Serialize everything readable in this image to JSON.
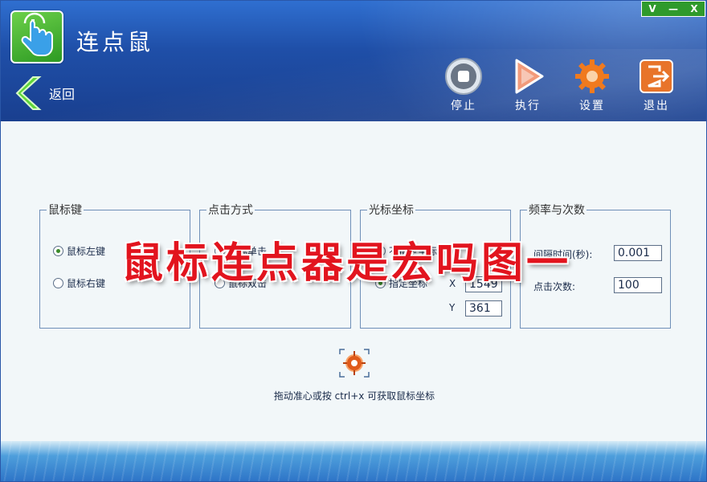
{
  "app": {
    "title": "连点鼠"
  },
  "window_controls": {
    "minimize": "V",
    "restore": "—",
    "close": "X"
  },
  "nav": {
    "back_label": "返回"
  },
  "toolbar": {
    "stop_label": "停止",
    "run_label": "执行",
    "settings_label": "设置",
    "exit_label": "退出"
  },
  "mouse_button": {
    "title": "鼠标键",
    "options": [
      "鼠标左键",
      "鼠标右键"
    ],
    "selected": "鼠标左键"
  },
  "click_mode": {
    "title": "点击方式",
    "options": [
      "鼠标单击",
      "鼠标双击"
    ],
    "selected": "鼠标单击"
  },
  "cursor_coords": {
    "title": "光标坐标",
    "options": [
      "不指定坐标",
      "指定坐标"
    ],
    "selected": "指定坐标",
    "x_label": "X",
    "x_value": "1549",
    "y_label": "Y",
    "y_value": "361"
  },
  "frequency": {
    "title": "频率与次数",
    "interval_label": "间隔时间(秒):",
    "interval_value": "0.001",
    "count_label": "点击次数:",
    "count_value": "100"
  },
  "hint": "拖动准心或按 ctrl+x 可获取鼠标坐标",
  "watermark": "鼠标连点器是宏吗图一",
  "icons": {
    "logo": "hand-click-icon",
    "back": "chevron-left-icon",
    "stop": "stop-icon",
    "run": "play-icon",
    "settings": "gear-icon",
    "exit": "exit-icon",
    "crosshair": "crosshair-icon"
  },
  "colors": {
    "header": "#1f4fa8",
    "accent_green": "#3a8a2a",
    "watermark": "#e2141e"
  }
}
